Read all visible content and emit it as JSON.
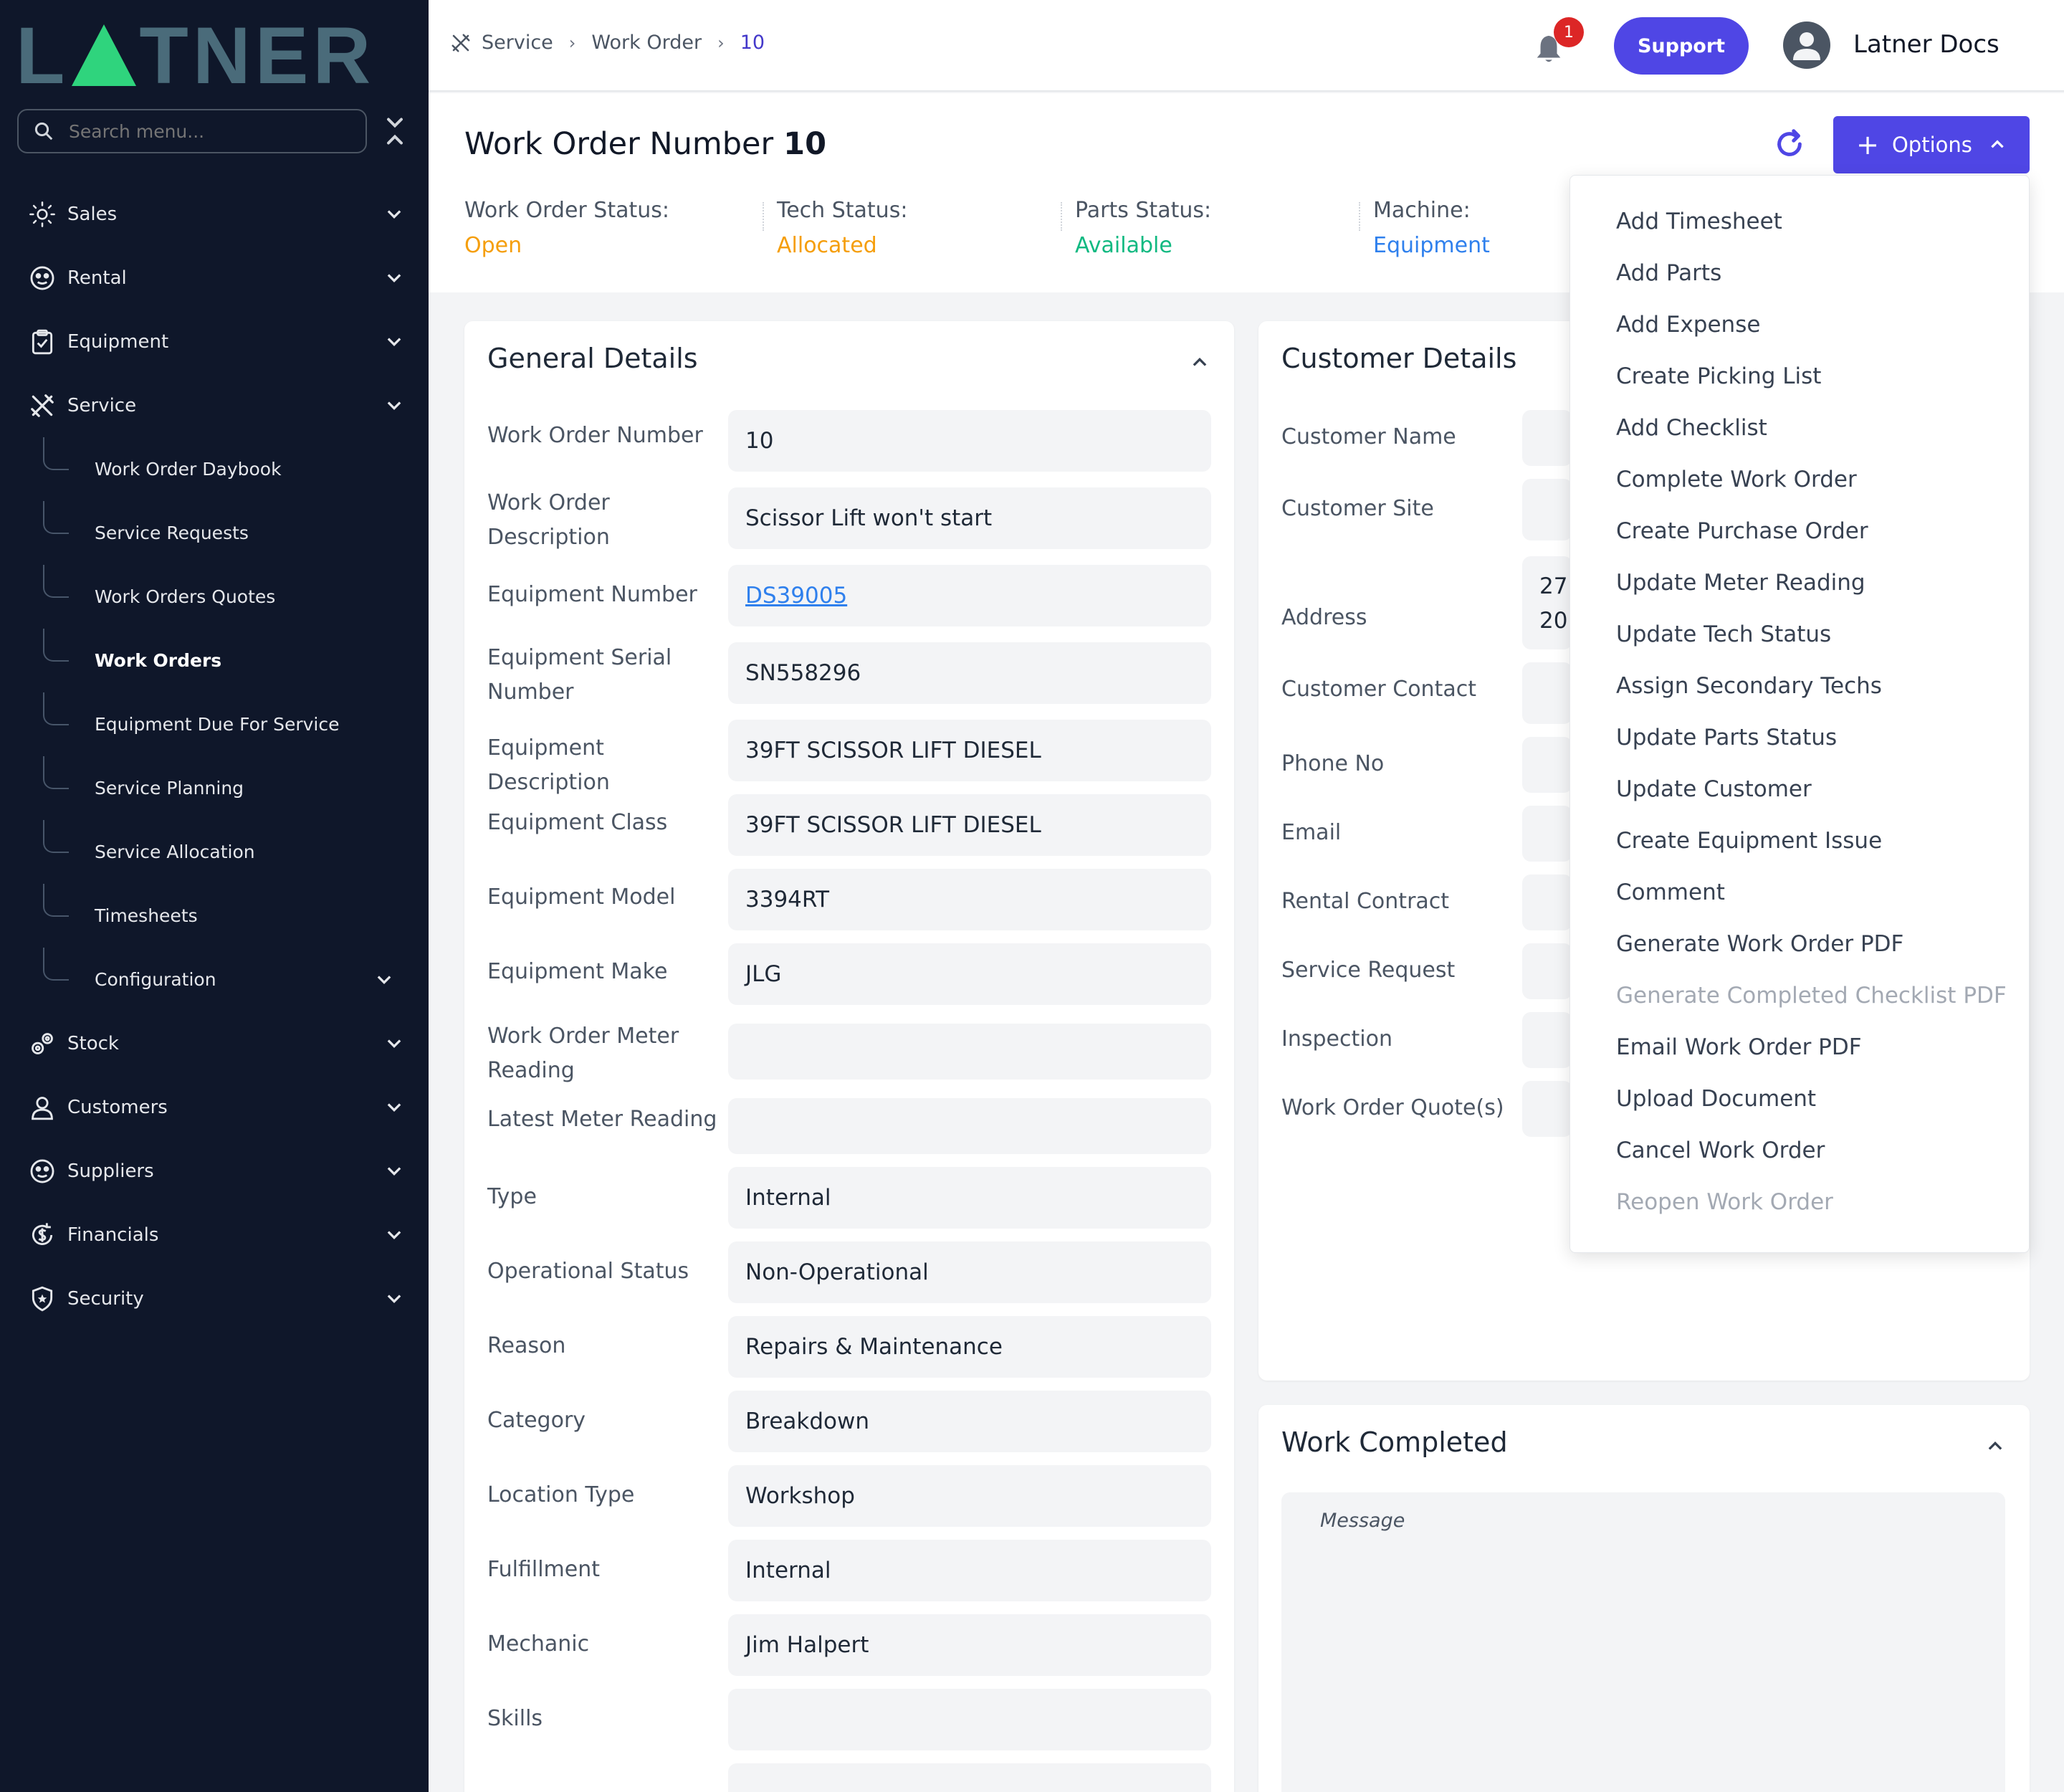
{
  "brand": {
    "logo_left": "L",
    "logo_right": "TNER",
    "accent": "#2fd47d"
  },
  "sidebar": {
    "search_placeholder": "Search menu...",
    "items": [
      {
        "label": "Sales"
      },
      {
        "label": "Rental"
      },
      {
        "label": "Equipment"
      },
      {
        "label": "Service"
      },
      {
        "label": "Stock"
      },
      {
        "label": "Customers"
      },
      {
        "label": "Suppliers"
      },
      {
        "label": "Financials"
      },
      {
        "label": "Security"
      }
    ],
    "service_children": [
      {
        "label": "Work Order Daybook"
      },
      {
        "label": "Service Requests"
      },
      {
        "label": "Work Orders Quotes"
      },
      {
        "label": "Work Orders"
      },
      {
        "label": "Equipment Due For Service"
      },
      {
        "label": "Service Planning"
      },
      {
        "label": "Service Allocation"
      },
      {
        "label": "Timesheets"
      },
      {
        "label": "Configuration"
      }
    ]
  },
  "topbar": {
    "breadcrumb": [
      "Service",
      "Work Order",
      "10"
    ],
    "notification_count": "1",
    "support_label": "Support",
    "user_name": "Latner Docs"
  },
  "header": {
    "title": "Work Order Number",
    "number": "10",
    "options_label": "Options",
    "statuses": [
      {
        "label": "Work Order Status:",
        "value": "Open",
        "color": "#f59e0b"
      },
      {
        "label": "Tech Status:",
        "value": "Allocated",
        "color": "#f59e0b"
      },
      {
        "label": "Parts Status:",
        "value": "Available",
        "color": "#10b981"
      },
      {
        "label": "Machine:",
        "value": "Equipment",
        "color": "#2f80ed"
      }
    ]
  },
  "general": {
    "title": "General Details",
    "fields": [
      {
        "label": "Work Order Number",
        "value": "10"
      },
      {
        "label": "Work Order Description",
        "value": "Scissor Lift won't start"
      },
      {
        "label": "Equipment Number",
        "value": "DS39005"
      },
      {
        "label": "Equipment Serial Number",
        "value": "SN558296"
      },
      {
        "label": "Equipment Description",
        "value": "39FT SCISSOR LIFT DIESEL"
      },
      {
        "label": "Equipment Class",
        "value": "39FT SCISSOR LIFT DIESEL"
      },
      {
        "label": "Equipment Model",
        "value": "3394RT"
      },
      {
        "label": "Equipment Make",
        "value": "JLG"
      },
      {
        "label": "Work Order Meter Reading",
        "value": ""
      },
      {
        "label": "Latest Meter Reading",
        "value": ""
      },
      {
        "label": "Type",
        "value": "Internal"
      },
      {
        "label": "Operational Status",
        "value": "Non-Operational"
      },
      {
        "label": "Reason",
        "value": "Repairs & Maintenance"
      },
      {
        "label": "Category",
        "value": "Breakdown"
      },
      {
        "label": "Location Type",
        "value": "Workshop"
      },
      {
        "label": "Fulfillment",
        "value": "Internal"
      },
      {
        "label": "Mechanic",
        "value": "Jim Halpert"
      },
      {
        "label": "Skills",
        "value": ""
      },
      {
        "label": "",
        "value": ""
      }
    ]
  },
  "customer": {
    "title": "Customer Details",
    "fields": [
      {
        "label": "Customer Name",
        "value": ""
      },
      {
        "label": "Customer Site",
        "value": ""
      },
      {
        "label": "Address",
        "value_line1": "27",
        "value_line2": "20"
      },
      {
        "label": "Customer Contact",
        "value": ""
      },
      {
        "label": "Phone No",
        "value": ""
      },
      {
        "label": "Email",
        "value": ""
      },
      {
        "label": "Rental Contract",
        "value": ""
      },
      {
        "label": "Service Request",
        "value": ""
      },
      {
        "label": "Inspection",
        "value": ""
      },
      {
        "label": "Work Order Quote(s)",
        "value": ""
      }
    ]
  },
  "work_completed": {
    "title": "Work Completed",
    "placeholder": "Message"
  },
  "options_menu": [
    {
      "label": "Add Timesheet",
      "disabled": false
    },
    {
      "label": "Add Parts",
      "disabled": false
    },
    {
      "label": "Add Expense",
      "disabled": false
    },
    {
      "label": "Create Picking List",
      "disabled": false
    },
    {
      "label": "Add Checklist",
      "disabled": false
    },
    {
      "label": "Complete Work Order",
      "disabled": false
    },
    {
      "label": "Create Purchase Order",
      "disabled": false
    },
    {
      "label": "Update Meter Reading",
      "disabled": false
    },
    {
      "label": "Update Tech Status",
      "disabled": false
    },
    {
      "label": "Assign Secondary Techs",
      "disabled": false
    },
    {
      "label": "Update Parts Status",
      "disabled": false
    },
    {
      "label": "Update Customer",
      "disabled": false
    },
    {
      "label": "Create Equipment Issue",
      "disabled": false
    },
    {
      "label": "Comment",
      "disabled": false
    },
    {
      "label": "Generate Work Order PDF",
      "disabled": false
    },
    {
      "label": "Generate Completed Checklist PDF",
      "disabled": true
    },
    {
      "label": "Email Work Order PDF",
      "disabled": false
    },
    {
      "label": "Upload Document",
      "disabled": false
    },
    {
      "label": "Cancel Work Order",
      "disabled": false
    },
    {
      "label": "Reopen Work Order",
      "disabled": true
    }
  ]
}
